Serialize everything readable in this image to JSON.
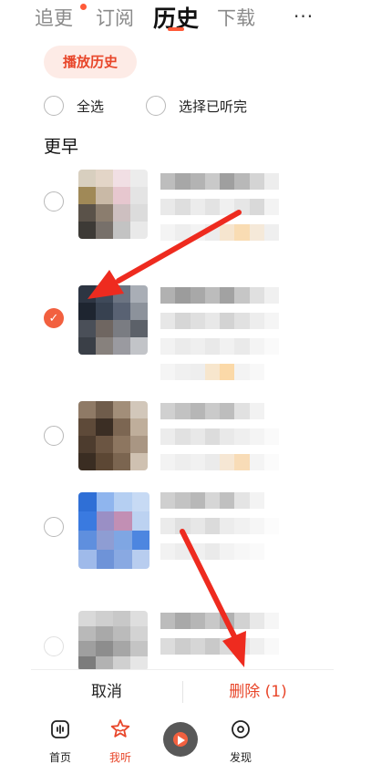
{
  "top_tabs": [
    "追更",
    "订阅",
    "历史",
    "下载"
  ],
  "more_label": "···",
  "chip_label": "播放历史",
  "select_all_label": "全选",
  "select_finished_label": "选择已听完",
  "section_title": "更早",
  "history_items": [
    {
      "checked": false
    },
    {
      "checked": true
    },
    {
      "checked": false
    },
    {
      "checked": false
    },
    {
      "checked": false
    }
  ],
  "checkmark": "✓",
  "bottom_bar": {
    "cancel_label": "取消",
    "delete_label": "删除 (1)"
  },
  "nav": {
    "items": [
      "首页",
      "我听",
      "发现"
    ]
  },
  "colors": {
    "accent": "#e8462a",
    "annotation_arrow": "#ee2b1f"
  },
  "icons": {
    "home": "home-icon",
    "listen": "star-face-icon",
    "discover": "discover-icon"
  }
}
